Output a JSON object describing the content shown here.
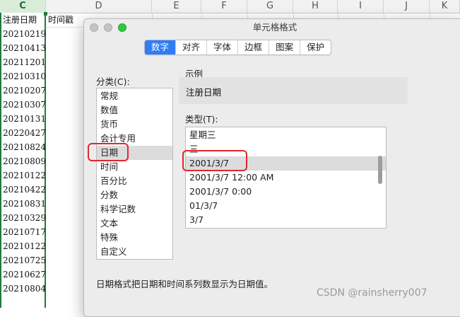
{
  "spreadsheet": {
    "columns": [
      {
        "letter": "C",
        "selected": true
      },
      {
        "letter": "D"
      },
      {
        "letter": "E"
      },
      {
        "letter": "F"
      },
      {
        "letter": "G"
      },
      {
        "letter": "H"
      },
      {
        "letter": "I"
      },
      {
        "letter": "J"
      },
      {
        "letter": "K"
      }
    ],
    "header_cells": {
      "c1": "注册日期",
      "d1": "时间戳"
    },
    "dates": [
      "20210219",
      "20210413",
      "20211201",
      "20210310",
      "20210207",
      "20210307",
      "20210131",
      "20220427",
      "20210824",
      "20210809",
      "20210122",
      "20210422",
      "20210831",
      "20210329",
      "20210717",
      "20210122",
      "20210725",
      "20210627",
      "20210804"
    ]
  },
  "dialog": {
    "title": "单元格格式",
    "tabs": [
      "数字",
      "对齐",
      "字体",
      "边框",
      "图案",
      "保护"
    ],
    "active_tab": "数字",
    "category_label": "分类(C):",
    "categories": [
      "常规",
      "数值",
      "货币",
      "会计专用",
      "日期",
      "时间",
      "百分比",
      "分数",
      "科学记数",
      "文本",
      "特殊",
      "自定义"
    ],
    "selected_category": "日期",
    "sample_label": "示例",
    "sample_value": "注册日期",
    "type_label": "类型(T):",
    "types": [
      "星期三",
      "三",
      "2001/3/7",
      "2001/3/7 12:00 AM",
      "2001/3/7 0:00",
      "01/3/7",
      "3/7"
    ],
    "selected_type": "2001/3/7",
    "description": "日期格式把日期和时间系列数显示为日期值。"
  },
  "colors": {
    "accent_blue": "#2f7cf6",
    "annotation_red": "#e0272f",
    "selection_green": "#1f7a3a"
  },
  "watermark": "CSDN @rainsherry007"
}
